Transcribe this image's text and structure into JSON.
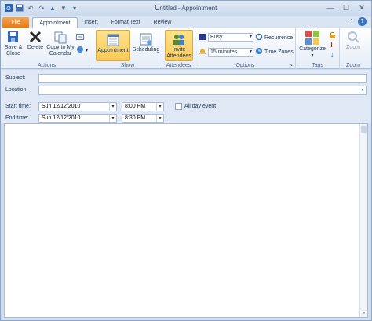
{
  "titlebar": {
    "title": "Untitled  -  Appointment",
    "qat": [
      "save-icon",
      "undo-icon",
      "redo-icon",
      "up-icon",
      "down-icon",
      "customize-icon"
    ]
  },
  "tabs": {
    "file": "File",
    "appointment": "Appointment",
    "insert": "Insert",
    "format_text": "Format Text",
    "review": "Review"
  },
  "ribbon": {
    "actions": {
      "label": "Actions",
      "save_close": [
        "Save &",
        "Close"
      ],
      "delete": "Delete",
      "copy_calendar": [
        "Copy to My",
        "Calendar"
      ]
    },
    "show": {
      "label": "Show",
      "appointment": "Appointment",
      "scheduling": "Scheduling"
    },
    "attendees": {
      "label": "Attendees",
      "invite": [
        "Invite",
        "Attendees"
      ]
    },
    "options": {
      "label": "Options",
      "show_as": "Busy",
      "reminder": "15 minutes",
      "recurrence": "Recurrence",
      "time_zones": "Time Zones"
    },
    "tags": {
      "label": "Tags",
      "categorize": "Categorize"
    },
    "zoom": {
      "label": "Zoom",
      "zoom": "Zoom"
    }
  },
  "form": {
    "subject_label": "Subject:",
    "location_label": "Location:",
    "start_label": "Start time:",
    "end_label": "End time:",
    "start_date": "Sun 12/12/2010",
    "start_time": "8:00 PM",
    "end_date": "Sun 12/12/2010",
    "end_time": "8:30 PM",
    "all_day": "All day event"
  }
}
